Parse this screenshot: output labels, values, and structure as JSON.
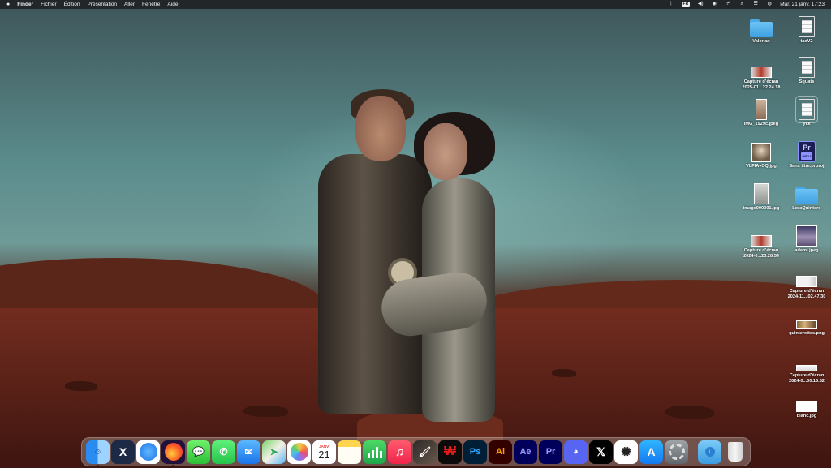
{
  "menubar": {
    "app_name": "Finder",
    "menus": [
      "Fichier",
      "Édition",
      "Présentation",
      "Aller",
      "Fenêtre",
      "Aide"
    ],
    "status": {
      "input_source": "FR",
      "datetime": "Mar. 21 janv.  17:23"
    }
  },
  "desktop": {
    "icons": [
      {
        "label": "Valerian",
        "kind": "folder"
      },
      {
        "label": "taxV2",
        "kind": "document"
      },
      {
        "label": "Capture d’écran\n2025-01...22.24.18",
        "kind": "screenshot"
      },
      {
        "label": "Squats",
        "kind": "document"
      },
      {
        "label": "IMG_1929c.jpeg",
        "kind": "photo"
      },
      {
        "label": "ykk",
        "kind": "document"
      },
      {
        "label": "VLFIAvOQ.jpg",
        "kind": "photo"
      },
      {
        "label": "Sans titre.prproj",
        "kind": "premiere-project"
      },
      {
        "label": "image000001.jpg",
        "kind": "photo"
      },
      {
        "label": "LoraQuintero",
        "kind": "folder"
      },
      {
        "label": "Capture d’écran\n2024-0...23.28.54",
        "kind": "screenshot"
      },
      {
        "label": "adami.jpeg",
        "kind": "photo"
      },
      {
        "label": "Capture d’écran\n2024-11...02.47.30",
        "kind": "screenshot"
      },
      {
        "label": "quinterettes.png",
        "kind": "image"
      },
      {
        "label": "Capture d’écran\n2024-0...00.15.52",
        "kind": "screenshot"
      },
      {
        "label": "blanc.jpg",
        "kind": "image"
      }
    ],
    "prproj_badge": {
      "main": "Pr",
      "sub": "PROJ"
    }
  },
  "dock": {
    "calendar": {
      "month": "JANV.",
      "day": "21"
    },
    "glyphs": {
      "xcode": "X",
      "messages": "💬",
      "whatsapp": "✆",
      "mail": "✉",
      "maps": "➤",
      "music": "♫",
      "brush": "🖌",
      "winamp": "₩",
      "photoshop": "Ps",
      "illustrator": "Ai",
      "after_effects": "Ae",
      "premiere": "Pr",
      "discord": "◕",
      "x_app": "𝕏",
      "chatgpt": "✺",
      "app_store": "A",
      "downloads": "↓"
    },
    "apps": [
      {
        "name": "Finder",
        "running": true
      },
      {
        "name": "Xcode",
        "running": false
      },
      {
        "name": "Safari",
        "running": false
      },
      {
        "name": "Firefox",
        "running": true
      },
      {
        "name": "Messages",
        "running": false
      },
      {
        "name": "WhatsApp",
        "running": false
      },
      {
        "name": "Mail",
        "running": false
      },
      {
        "name": "Plans",
        "running": false
      },
      {
        "name": "Photos",
        "running": false
      },
      {
        "name": "Calendrier",
        "running": false
      },
      {
        "name": "Notes",
        "running": false
      },
      {
        "name": "Numbers",
        "running": false
      },
      {
        "name": "Musique",
        "running": false
      },
      {
        "name": "Pinceau",
        "running": false
      },
      {
        "name": "Winamp",
        "running": false
      },
      {
        "name": "Photoshop",
        "running": false
      },
      {
        "name": "Illustrator",
        "running": false
      },
      {
        "name": "After Effects",
        "running": false
      },
      {
        "name": "Premiere Pro",
        "running": false
      },
      {
        "name": "Discord",
        "running": false
      },
      {
        "name": "X",
        "running": false
      },
      {
        "name": "ChatGPT",
        "running": false
      },
      {
        "name": "App Store",
        "running": false
      },
      {
        "name": "Réglages Système",
        "running": false
      },
      {
        "name": "Téléchargements",
        "running": false
      },
      {
        "name": "Corbeille",
        "running": false
      }
    ]
  },
  "colors": {
    "menubar_bg": "#1c1c1e",
    "folder_blue": "#49a8e8",
    "sky_teal": "#5b8c8c",
    "mars_red": "#6b2a1d"
  }
}
